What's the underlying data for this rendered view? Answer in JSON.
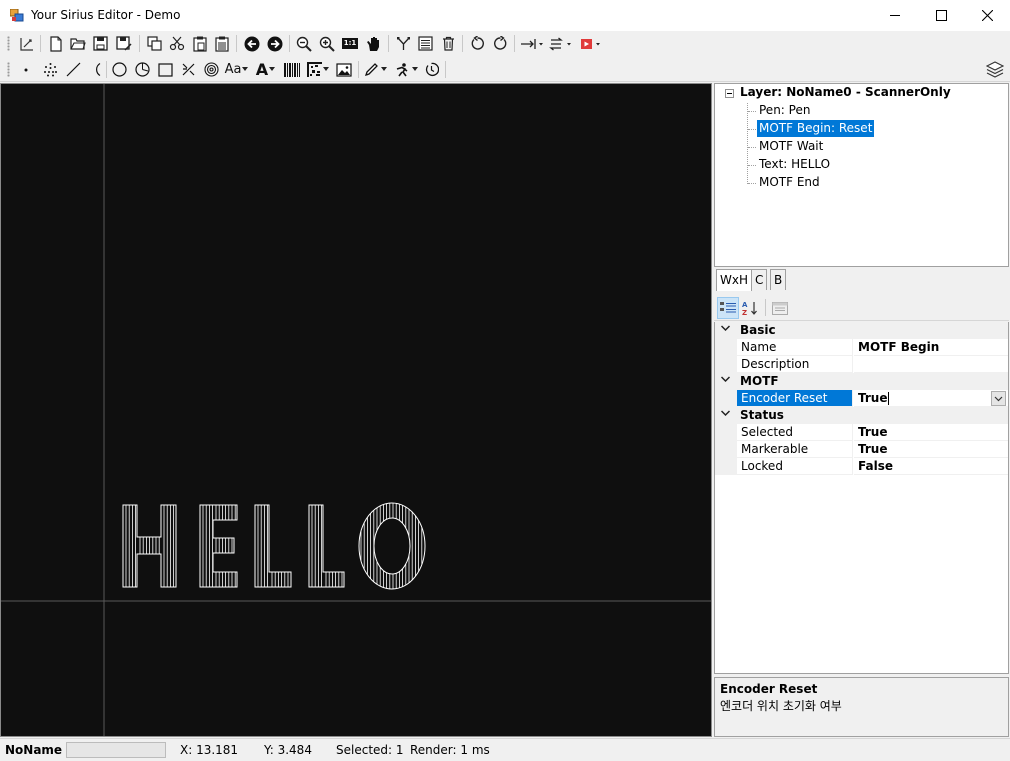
{
  "window": {
    "title": "Your Sirius Editor - Demo",
    "controls": [
      "minimize-icon",
      "maximize-icon",
      "close-icon"
    ]
  },
  "toolbar1": {
    "icons": [
      "new-document-icon",
      "open-folder-icon",
      "save-icon",
      "save-as-icon",
      "copy-icon",
      "cut-icon",
      "paste-icon",
      "paste-array-icon",
      "arrow-left-icon",
      "arrow-right-icon",
      "zoom-out-icon",
      "zoom-in-icon",
      "zoom-actual-icon",
      "pan-hand-icon",
      "node-edit-icon",
      "list-icon",
      "delete-icon",
      "rotate-ccw-icon",
      "rotate-cw-icon",
      "align-dropdown-icon",
      "sort-dropdown-icon",
      "laser-dropdown-icon"
    ],
    "zoom_actual_label": "1:1"
  },
  "toolbar2": {
    "icons": [
      "point-icon",
      "points-icon",
      "line-icon",
      "arc-icon",
      "circle-icon",
      "trepan-icon",
      "rectangle-icon",
      "hatch-icon",
      "spiral-icon",
      "text-icon",
      "sirius-text-icon",
      "barcode-icon",
      "matrix-code-icon",
      "image-icon",
      "pen-icon",
      "motf-icon",
      "timer-icon",
      "layers-icon"
    ],
    "text_small_label": "Aa",
    "text_large_label": "A"
  },
  "tree": {
    "root": "Layer: NoName0 - ScannerOnly",
    "children": [
      {
        "label": "Pen: Pen"
      },
      {
        "label": "MOTF Begin: Reset",
        "selected": true
      },
      {
        "label": "MOTF Wait"
      },
      {
        "label": "Text: HELLO"
      },
      {
        "label": "MOTF End"
      }
    ]
  },
  "tabs": [
    {
      "label": "WxH",
      "active": true
    },
    {
      "label": "C"
    },
    {
      "label": "B"
    }
  ],
  "property_grid": {
    "categories": [
      {
        "name": "Basic",
        "props": [
          {
            "key": "Name",
            "value": "MOTF Begin"
          },
          {
            "key": "Description",
            "value": ""
          }
        ]
      },
      {
        "name": "MOTF",
        "props": [
          {
            "key": "Encoder Reset",
            "value": "True",
            "selected": true,
            "dropdown": true
          }
        ]
      },
      {
        "name": "Status",
        "props": [
          {
            "key": "Selected",
            "value": "True"
          },
          {
            "key": "Markerable",
            "value": "True"
          },
          {
            "key": "Locked",
            "value": "False"
          }
        ]
      }
    ]
  },
  "help": {
    "title": "Encoder Reset",
    "description": "엔코더 위치 초기화 여부"
  },
  "status": {
    "document_name": "NoName",
    "x": "X: 13.181",
    "y": "Y: 3.484",
    "selected": "Selected: 1",
    "render": "Render: 1 ms"
  },
  "canvas": {
    "text": "HELLO",
    "background": "#0f0f0f",
    "axis_color": "#5a5a5a",
    "stroke_color": "#ffffff"
  },
  "colors": {
    "selection": "#0078d7"
  }
}
